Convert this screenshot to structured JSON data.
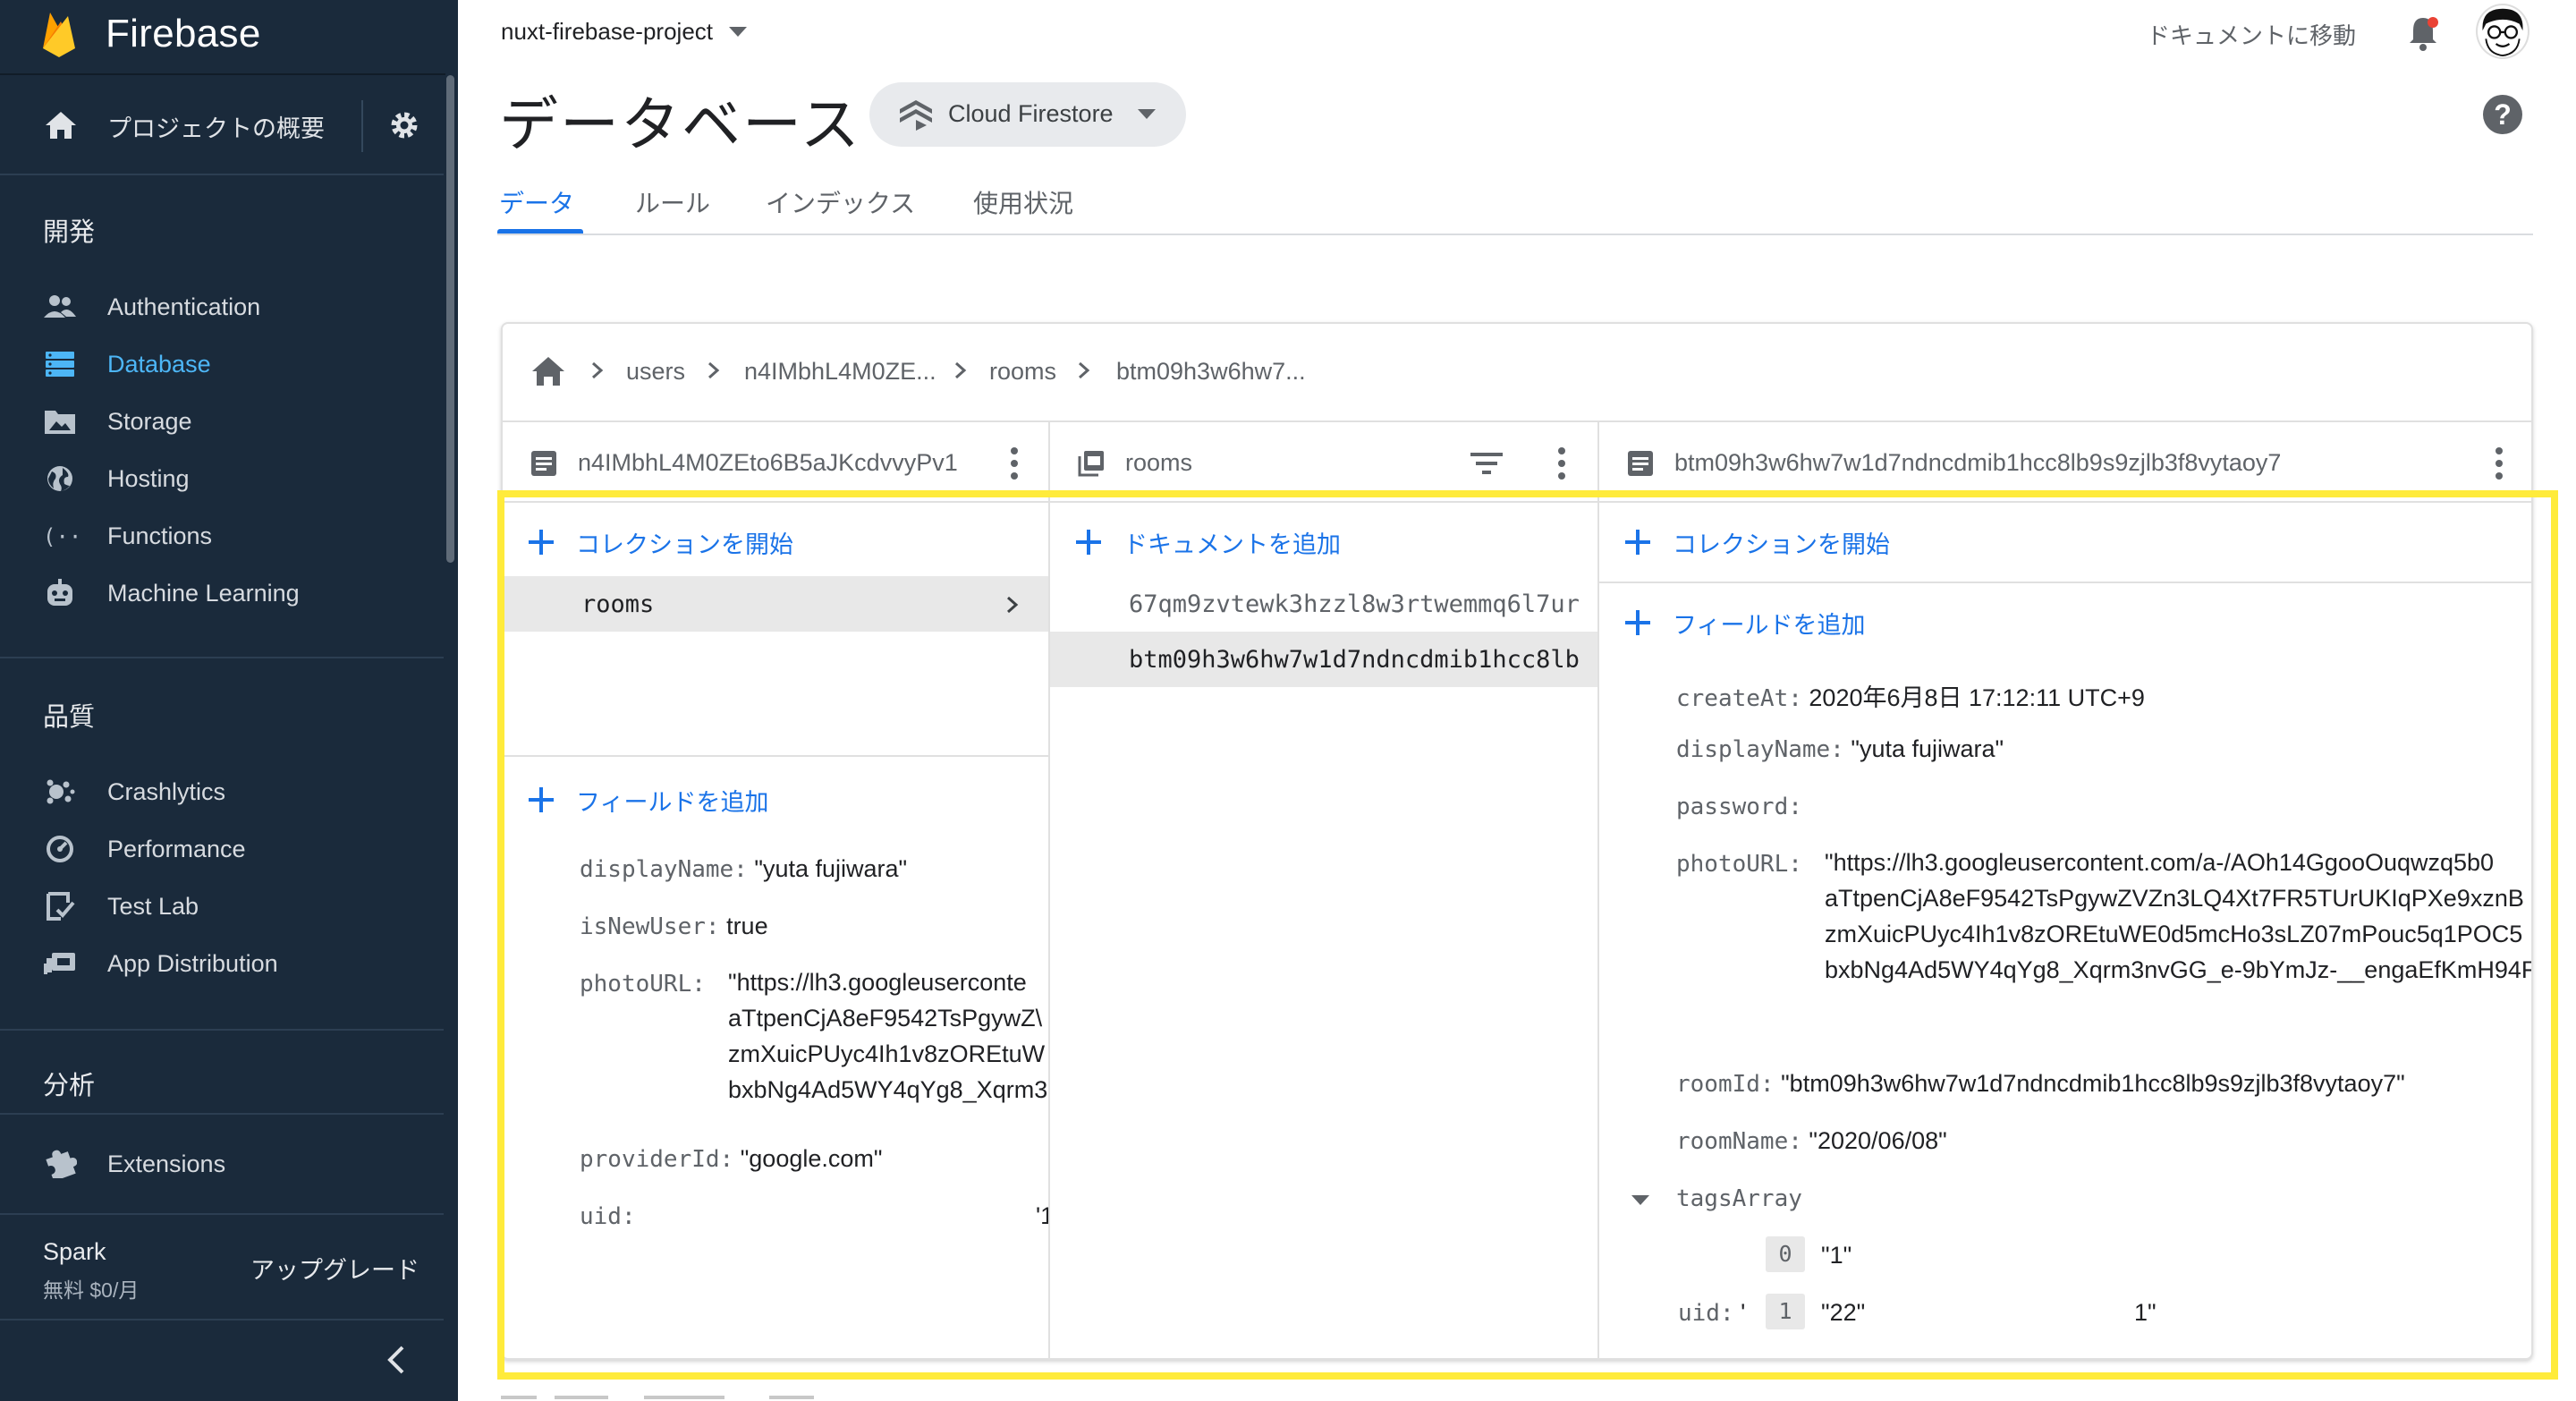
{
  "sidebar": {
    "brand": "Firebase",
    "overview": "プロジェクトの概要",
    "sections": [
      {
        "title": "開発",
        "items": [
          "Authentication",
          "Database",
          "Storage",
          "Hosting",
          "Functions",
          "Machine Learning"
        ]
      },
      {
        "title": "品質",
        "items": [
          "Crashlytics",
          "Performance",
          "Test Lab",
          "App Distribution"
        ]
      },
      {
        "title": "分析",
        "items": []
      }
    ],
    "extensions": "Extensions",
    "active_item": "Database",
    "plan_name": "Spark",
    "plan_price": "無料 $0/月",
    "upgrade": "アップグレード"
  },
  "header": {
    "project": "nuxt-firebase-project",
    "docs_link": "ドキュメントに移動",
    "title": "データベース",
    "db_select": "Cloud Firestore"
  },
  "tabs": [
    "データ",
    "ルール",
    "インデックス",
    "使用状況"
  ],
  "breadcrumb": [
    "users",
    "n4IMbhL4M0ZE...",
    "rooms",
    "btm09h3w6hw7..."
  ],
  "columns": {
    "user_doc": {
      "title": "n4IMbhL4M0ZEto6B5aJKcdvvyPv1",
      "add_collection": "コレクションを開始",
      "collections": [
        "rooms"
      ],
      "add_field": "フィールドを追加",
      "fields": {
        "displayName_k": "displayName:",
        "displayName_v": "\"yuta fujiwara\"",
        "isNewUser_k": "isNewUser:",
        "isNewUser_v": "true",
        "photoURL_k": "photoURL:",
        "photoURL_lines": [
          "\"https://lh3.googleuserconte",
          "aTtpenCjA8eF9542TsPgywZ\\",
          "zmXuicPUyc4Ih1v8zOREtuW",
          "bxbNg4Ad5WY4qYg8_Xqrm3"
        ],
        "providerId_k": "providerId:",
        "providerId_v": "\"google.com\"",
        "uid_k": "uid:",
        "uid_v": "'1"
      }
    },
    "rooms": {
      "title": "rooms",
      "add_document": "ドキュメントを追加",
      "documents": [
        "67qm9zvtewk3hzzl8w3rtwemmq6l7ur",
        "btm09h3w6hw7w1d7ndncdmib1hcc8lb"
      ]
    },
    "room_doc": {
      "title": "btm09h3w6hw7w1d7ndncdmib1hcc8lb9s9zjlb3f8vytaoy7",
      "add_collection": "コレクションを開始",
      "add_field": "フィールドを追加",
      "createAt_k": "createAt:",
      "createAt_v": "2020年6月8日 17:12:11 UTC+9",
      "displayName_k": "displayName:",
      "displayName_v": "\"yuta fujiwara\"",
      "password_k": "password:",
      "photoURL_k": "photoURL:",
      "photoURL_lines": [
        "\"https://lh3.googleusercontent.com/a-/AOh14GgooOuqwzq5b0",
        "aTtpenCjA8eF9542TsPgywZVZn3LQ4Xt7FR5TUrUKIqPXe9xznB",
        "zmXuicPUyc4Ih1v8zOREtuWE0d5mcHo3sLZ07mPouc5q1POC5",
        "bxbNg4Ad5WY4qYg8_Xqrm3nvGG_e-9bYmJz-__engaEfKmH94F"
      ],
      "roomId_k": "roomId:",
      "roomId_v": "\"btm09h3w6hw7w1d7ndncdmib1hcc8lb9s9zjlb3f8vytaoy7\"",
      "roomName_k": "roomName:",
      "roomName_v": "\"2020/06/08\"",
      "tagsArray_k": "tagsArray",
      "tags": [
        {
          "i": "0",
          "v": "\"1\""
        },
        {
          "i": "1",
          "v": "\"22\""
        }
      ],
      "uid_k": "uid:",
      "uid_v1": "'",
      "uid_v2": "1\""
    }
  },
  "colors": {
    "sidebar_bg": "#1a2a3b",
    "accent": "#1a73e8",
    "active_nav": "#4db6f6",
    "highlight": "#ffeb3b"
  }
}
